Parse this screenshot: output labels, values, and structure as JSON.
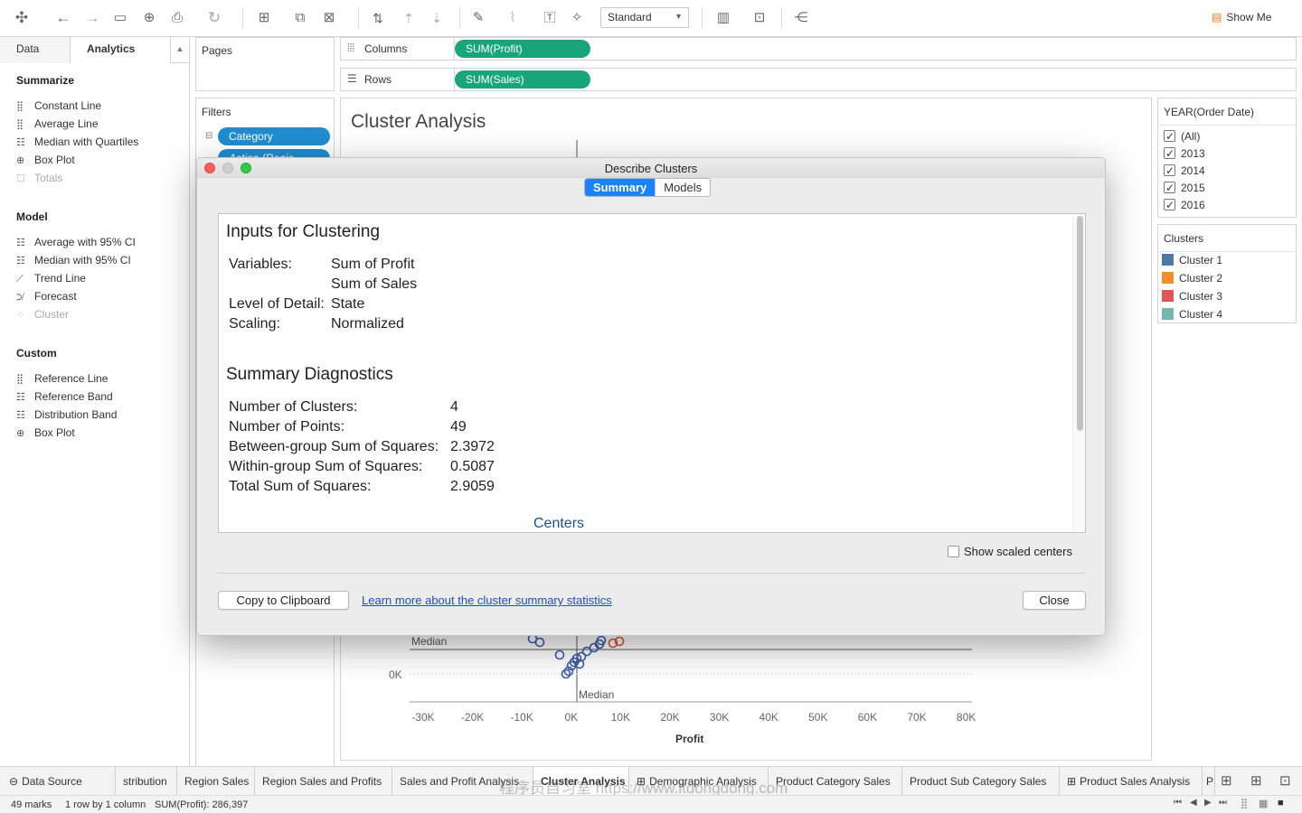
{
  "toolbar": {
    "view_mode": "Standard",
    "show_me": "Show Me"
  },
  "left_pane": {
    "tabs": [
      "Data",
      "Analytics"
    ],
    "sections": [
      {
        "title": "Summarize",
        "items": [
          {
            "label": "Constant Line",
            "enabled": true
          },
          {
            "label": "Average Line",
            "enabled": true
          },
          {
            "label": "Median with Quartiles",
            "enabled": true
          },
          {
            "label": "Box Plot",
            "enabled": true
          },
          {
            "label": "Totals",
            "enabled": false
          }
        ]
      },
      {
        "title": "Model",
        "items": [
          {
            "label": "Average with 95% CI",
            "enabled": true
          },
          {
            "label": "Median with 95% CI",
            "enabled": true
          },
          {
            "label": "Trend Line",
            "enabled": true
          },
          {
            "label": "Forecast",
            "enabled": true
          },
          {
            "label": "Cluster",
            "enabled": false
          }
        ]
      },
      {
        "title": "Custom",
        "items": [
          {
            "label": "Reference Line",
            "enabled": true
          },
          {
            "label": "Reference Band",
            "enabled": true
          },
          {
            "label": "Distribution Band",
            "enabled": true
          },
          {
            "label": "Box Plot",
            "enabled": true
          }
        ]
      }
    ]
  },
  "shelves": {
    "pages": "Pages",
    "filters": "Filters",
    "filter_pills": [
      "Category",
      "Action (Regio..."
    ],
    "columns_label": "Columns",
    "columns_pill": "SUM(Profit)",
    "rows_label": "Rows",
    "rows_pill": "SUM(Sales)"
  },
  "view": {
    "title": "Cluster Analysis",
    "median_h": "Median",
    "median_v": "Median",
    "y_tick": "0K",
    "x_ticks": [
      "-30K",
      "-20K",
      "-10K",
      "0K",
      "10K",
      "20K",
      "30K",
      "40K",
      "50K",
      "60K",
      "70K",
      "80K"
    ],
    "x_label": "Profit"
  },
  "year_legend": {
    "title": "YEAR(Order Date)",
    "items": [
      "(All)",
      "2013",
      "2014",
      "2015",
      "2016"
    ]
  },
  "cluster_legend": {
    "title": "Clusters",
    "items": [
      {
        "label": "Cluster 1",
        "color": "#4e79a7"
      },
      {
        "label": "Cluster 2",
        "color": "#f28e2b"
      },
      {
        "label": "Cluster 3",
        "color": "#e15759"
      },
      {
        "label": "Cluster 4",
        "color": "#76b7b2"
      }
    ]
  },
  "dialog": {
    "title": "Describe Clusters",
    "tabs": [
      "Summary",
      "Models"
    ],
    "inputs_heading": "Inputs for Clustering",
    "variables_label": "Variables:",
    "variables": [
      "Sum of Profit",
      "Sum of Sales"
    ],
    "lod_label": "Level of Detail:",
    "lod_value": "State",
    "scaling_label": "Scaling:",
    "scaling_value": "Normalized",
    "diag_heading": "Summary Diagnostics",
    "diagnostics": [
      {
        "label": "Number of Clusters:",
        "value": "4"
      },
      {
        "label": "Number of Points:",
        "value": "49"
      },
      {
        "label": "Between-group Sum of Squares:",
        "value": "2.3972"
      },
      {
        "label": "Within-group Sum of Squares:",
        "value": "0.5087"
      },
      {
        "label": "Total Sum of Squares:",
        "value": "2.9059"
      }
    ],
    "centers_heading": "Centers",
    "show_scaled": "Show scaled centers",
    "copy_button": "Copy to Clipboard",
    "learn_link": "Learn more about the cluster summary statistics",
    "close_button": "Close"
  },
  "bottom_tabs": {
    "data_source": "Data Source",
    "sheets": [
      "stribution",
      "Region Sales",
      "Region Sales and Profits",
      "Sales and Profit Analysis",
      "Cluster Analysis",
      "Demographic Analysis",
      "Product Category Sales",
      "Product Sub Category Sales",
      "Product Sales Analysis",
      "P"
    ],
    "active": "Cluster Analysis"
  },
  "status": {
    "marks": "49 marks",
    "rows_cols": "1 row by 1 column",
    "sum": "SUM(Profit): 286,397"
  },
  "watermark": "程序员自习室 https://www.itdongdong.com"
}
